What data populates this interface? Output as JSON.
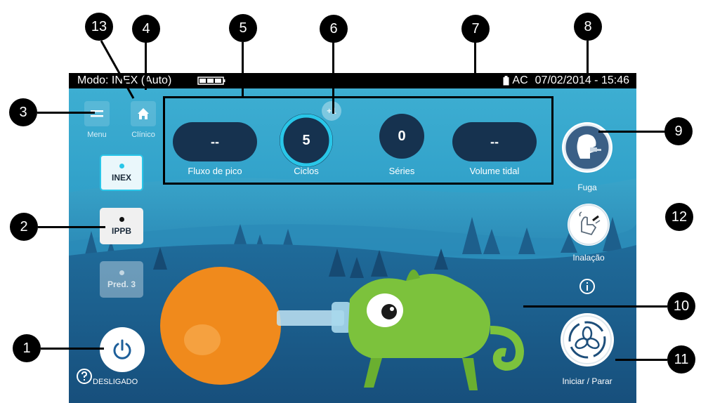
{
  "status_bar": {
    "mode_text": "Modo: INEX (Auto)",
    "power_source": "AC",
    "datetime": "07/02/2014 - 15:46"
  },
  "top_nav": {
    "menu_label": "Menu",
    "clinical_label": "Clínico"
  },
  "mode_buttons": [
    {
      "label": "INEX",
      "state": "selected"
    },
    {
      "label": "IPPB",
      "state": "available"
    },
    {
      "label": "Pred. 3",
      "state": "disabled"
    }
  ],
  "stats": {
    "peak_flow": {
      "label": "Fluxo de pico",
      "value": "--"
    },
    "cycles": {
      "label": "Ciclos",
      "value": "5",
      "increment_badge": "+1"
    },
    "series": {
      "label": "Séries",
      "value": "0"
    },
    "tidal_volume": {
      "label": "Volume tidal",
      "value": "--"
    }
  },
  "right_controls": {
    "leak_label": "Fuga",
    "inhalation_label": "Inalação",
    "start_stop_label": "Iniciar / Parar"
  },
  "power": {
    "label": "DESLIGADO"
  },
  "callouts": [
    "1",
    "2",
    "3",
    "4",
    "5",
    "6",
    "7",
    "8",
    "9",
    "10",
    "11",
    "12",
    "13"
  ],
  "colors": {
    "sky_top": "#3fb0d3",
    "pill_dark": "#16324f",
    "accent_cyan": "#29c6e8",
    "chameleon_green": "#7cc23c",
    "balloon_orange": "#f08a1c"
  }
}
